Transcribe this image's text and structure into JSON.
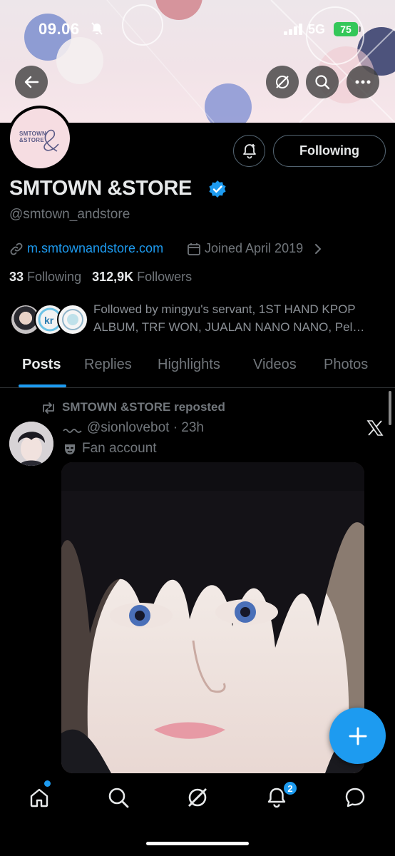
{
  "status_bar": {
    "time": "09.06",
    "network": "5G",
    "battery": "75"
  },
  "profile": {
    "display_name": "SMTOWN &STORE",
    "handle": "@smtown_andstore",
    "website": "m.smtownandstore.com",
    "joined": "Joined April 2019",
    "following_count": "33",
    "following_label": "Following",
    "followers_count": "312,9K",
    "followers_label": "Followers",
    "followed_by": "Followed by mingyu's servant, 1ST HAND KPOP ALBUM, TRF WON, JUALAN NANO NANO, Pel…",
    "avatar_logo_text": "SMTOWN &STORE",
    "follow_button": "Following"
  },
  "tabs": [
    {
      "label": "Posts",
      "active": true
    },
    {
      "label": "Replies",
      "active": false
    },
    {
      "label": "Highlights",
      "active": false
    },
    {
      "label": "Videos",
      "active": false
    },
    {
      "label": "Photos",
      "active": false
    }
  ],
  "post": {
    "repost_label": "SMTOWN &STORE reposted",
    "author_handle": "@sionlovebot",
    "time": "23h",
    "handle_time": "@sionlovebot · 23h",
    "account_label": "Fan account"
  },
  "bottom_nav": {
    "notifications_badge": "2"
  },
  "colors": {
    "accent": "#1d9bf0",
    "background": "#000000",
    "secondary_text": "#71767b",
    "battery_green": "#34c759"
  },
  "icons": {
    "back": "arrow-left-icon",
    "grok": "grok-icon",
    "search": "search-icon",
    "more": "more-horizontal-icon",
    "notify": "bell-plus-icon",
    "verified": "verified-badge-icon",
    "link": "link-icon",
    "calendar": "calendar-icon",
    "repost": "repost-icon",
    "compose": "plus-icon"
  }
}
